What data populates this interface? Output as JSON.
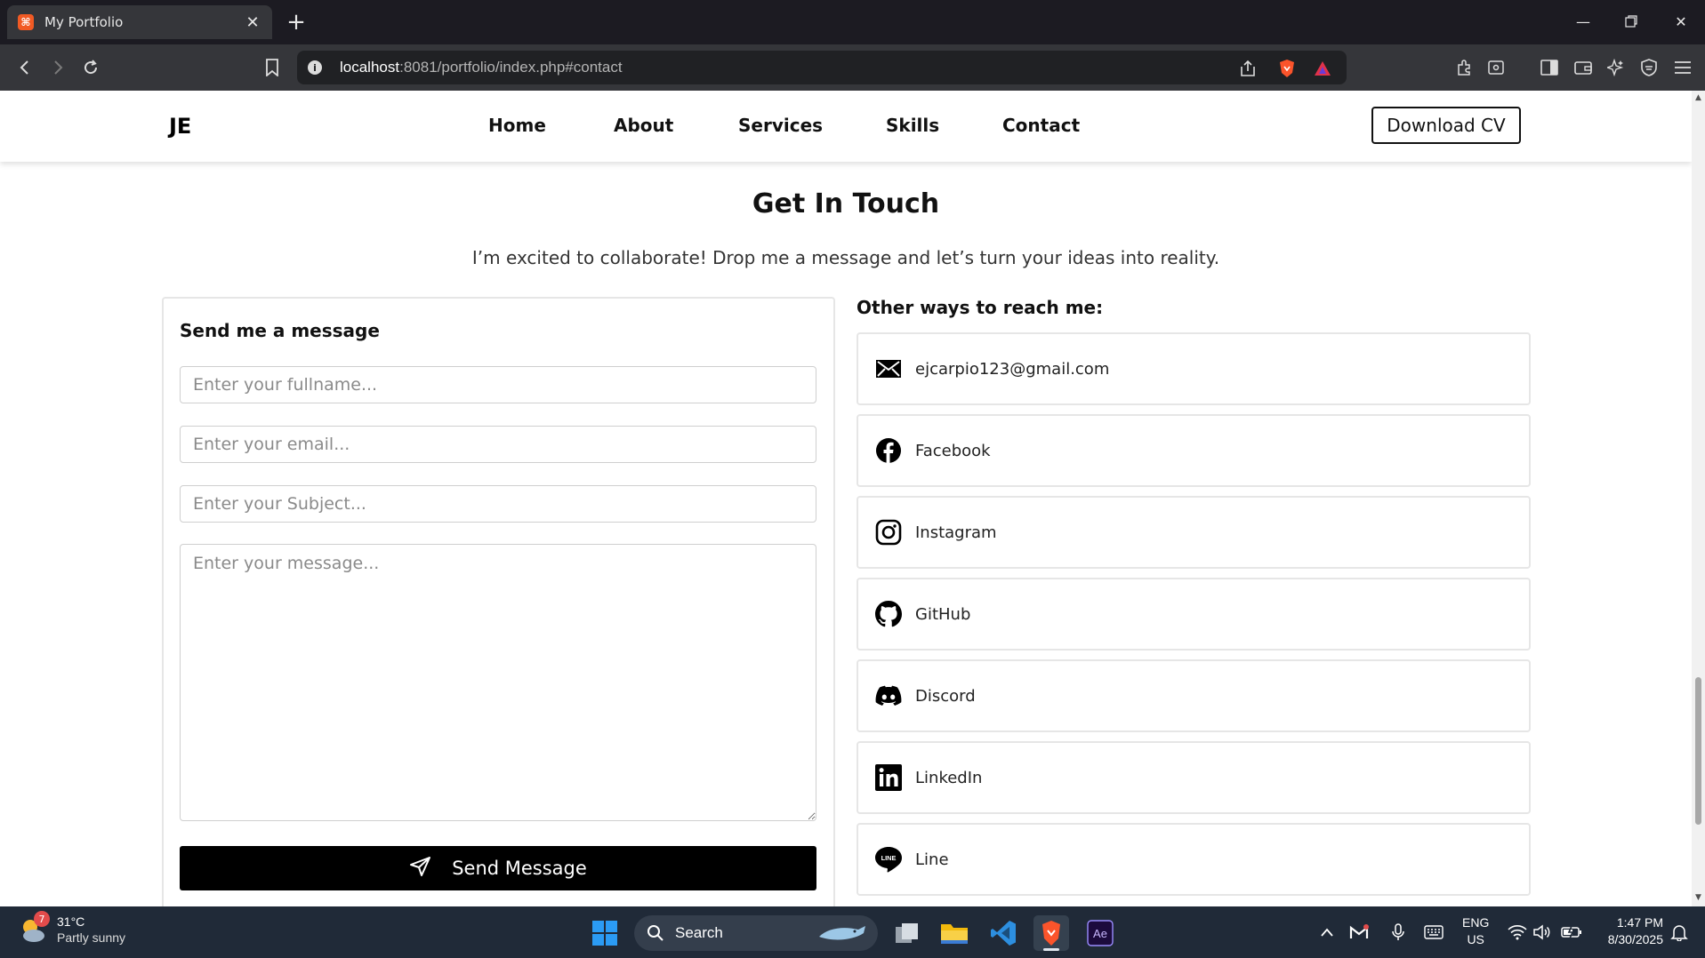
{
  "browser": {
    "tab_title": "My Portfolio",
    "url_host": "localhost",
    "url_path": ":8081/portfolio/index.php#contact"
  },
  "site": {
    "logo": "JE",
    "menu": [
      "Home",
      "About",
      "Services",
      "Skills",
      "Contact"
    ],
    "cv_button": "Download CV"
  },
  "contact": {
    "title": "Get In Touch",
    "subtitle": "I’m excited to collaborate! Drop me a message and let’s turn your ideas into reality.",
    "form": {
      "heading": "Send me a message",
      "fullname_placeholder": "Enter your fullname...",
      "email_placeholder": "Enter your email...",
      "subject_placeholder": "Enter your Subject...",
      "message_placeholder": "Enter your message...",
      "send_label": "Send Message"
    },
    "other_heading": "Other ways to reach me:",
    "channels": [
      {
        "label": "ejcarpio123@gmail.com",
        "icon": "envelope-icon"
      },
      {
        "label": "Facebook",
        "icon": "facebook-icon"
      },
      {
        "label": "Instagram",
        "icon": "instagram-icon"
      },
      {
        "label": "GitHub",
        "icon": "github-icon"
      },
      {
        "label": "Discord",
        "icon": "discord-icon"
      },
      {
        "label": "LinkedIn",
        "icon": "linkedin-icon"
      },
      {
        "label": "Line",
        "icon": "line-icon"
      }
    ]
  },
  "taskbar": {
    "weather_temp": "31°C",
    "weather_cond": "Partly sunny",
    "weather_badge": "7",
    "search_label": "Search",
    "lang": "ENG",
    "region": "US",
    "time": "1:47 PM",
    "date": "8/30/2025"
  },
  "colors": {
    "accent": "#000000",
    "browser_dark": "#35363a",
    "taskbar": "#202a38"
  }
}
